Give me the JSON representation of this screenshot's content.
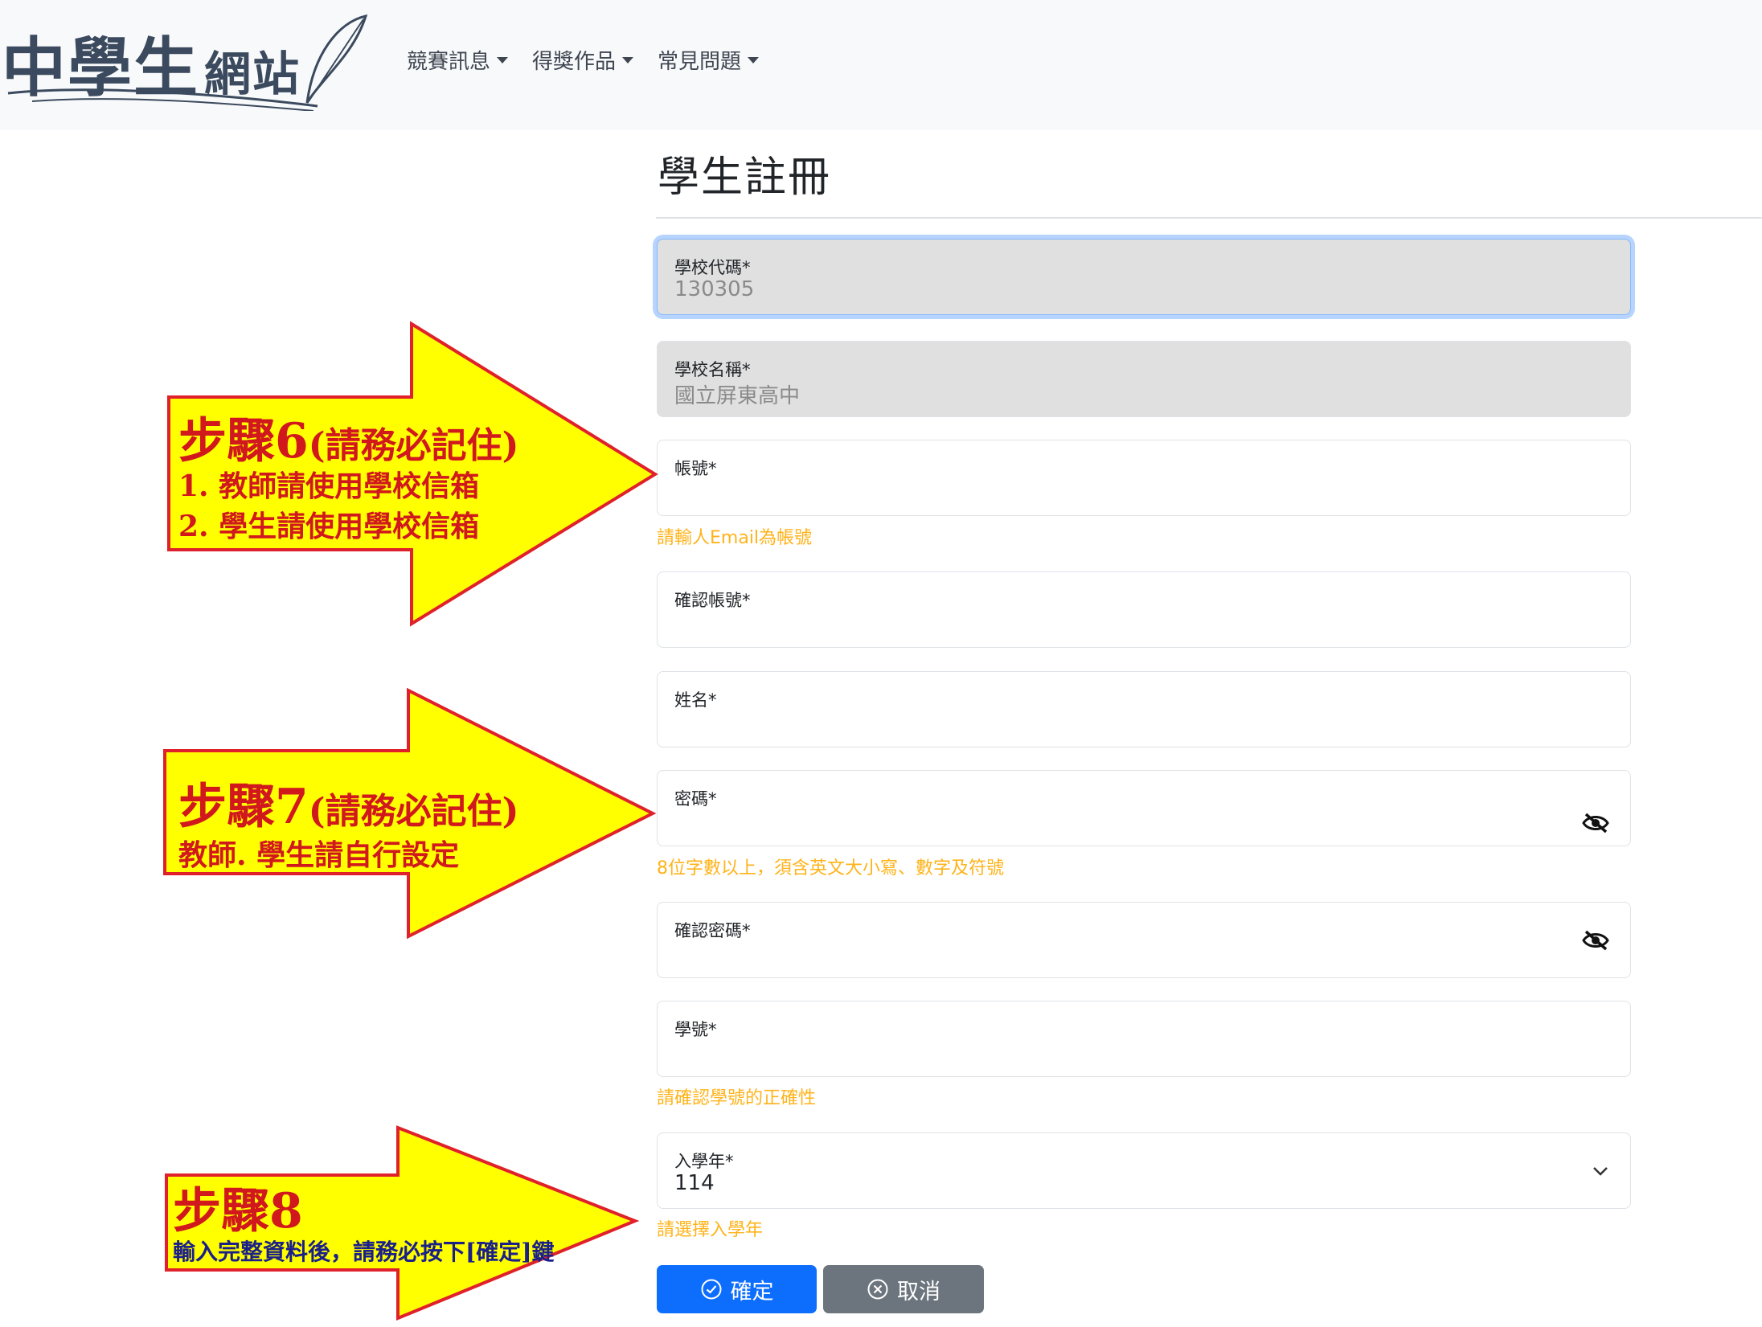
{
  "site": {
    "logo_text_big": "中學生",
    "logo_text_small": "網站"
  },
  "nav": {
    "items": [
      "競賽訊息",
      "得獎作品",
      "常見問題"
    ]
  },
  "page": {
    "title": "學生註冊"
  },
  "form": {
    "school_code": {
      "label": "學校代碼*",
      "value": "130305"
    },
    "school_name": {
      "label": "學校名稱*",
      "value": "國立屏東高中"
    },
    "account": {
      "label": "帳號*",
      "value": "",
      "hint": "請輸人Email為帳號"
    },
    "confirm_account": {
      "label": "確認帳號*",
      "value": ""
    },
    "name": {
      "label": "姓名*",
      "value": ""
    },
    "password": {
      "label": "密碼*",
      "value": "",
      "hint": "8位字數以上，須含英文大小寫、數字及符號"
    },
    "confirm_password": {
      "label": "確認密碼*",
      "value": ""
    },
    "student_id": {
      "label": "學號*",
      "value": "",
      "hint": "請確認學號的正確性"
    },
    "enroll_year": {
      "label": "入學年*",
      "value": "114",
      "hint": "請選擇入學年"
    },
    "ok_label": "確定",
    "cancel_label": "取消"
  },
  "annotations": {
    "step6": {
      "title": "步驟6",
      "note": "(請務必記住)",
      "line1": "1. 教師請使用學校信箱",
      "line2": "2. 學生請使用學校信箱"
    },
    "step7": {
      "title": "步驟7",
      "note": "(請務必記住)",
      "line1": "教師. 學生請自行設定"
    },
    "step8": {
      "title": "步驟8",
      "line1": "輸入完整資料後，請務必按下[確定]鍵"
    }
  },
  "colors": {
    "primary": "#0d6efd",
    "secondary": "#6c757d",
    "hint": "#ffb31a",
    "arrow_fill": "#ffff00",
    "arrow_stroke": "#e0202a",
    "annotation_text": "#d0181d"
  }
}
